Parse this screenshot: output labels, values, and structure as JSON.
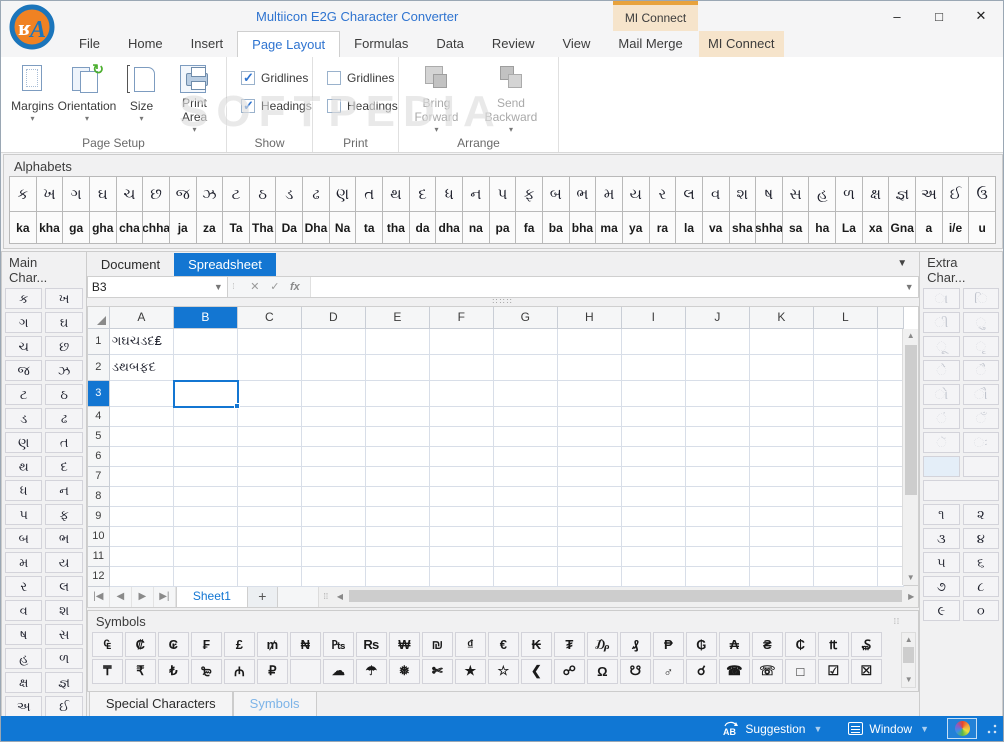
{
  "window": {
    "title": "Multiicon E2G Character Converter",
    "controls": [
      {
        "name": "minimize",
        "glyph": "–"
      },
      {
        "name": "maximize",
        "glyph": "□"
      },
      {
        "name": "close",
        "glyph": "✕"
      }
    ]
  },
  "ribbon": {
    "contextual_header": "MI Connect",
    "active_tab": "Page Layout",
    "tabs": [
      {
        "label": "File"
      },
      {
        "label": "Home"
      },
      {
        "label": "Insert"
      },
      {
        "label": "Page Layout"
      },
      {
        "label": "Formulas"
      },
      {
        "label": "Data"
      },
      {
        "label": "Review"
      },
      {
        "label": "View"
      },
      {
        "label": "Mail Merge"
      },
      {
        "label": "MI Connect",
        "contextual": true
      }
    ],
    "groups": {
      "page_setup": {
        "label": "Page Setup",
        "buttons": [
          "Margins",
          "Orientation",
          "Size",
          "Print Area"
        ]
      },
      "show": {
        "label": "Show",
        "checks": [
          {
            "label": "Gridlines",
            "checked": true
          },
          {
            "label": "Headings",
            "checked": true
          }
        ]
      },
      "print": {
        "label": "Print",
        "checks": [
          {
            "label": "Gridlines",
            "checked": false
          },
          {
            "label": "Headings",
            "checked": false
          }
        ]
      },
      "arrange": {
        "label": "Arrange",
        "buttons": [
          "Bring Forward",
          "Send Backward"
        ]
      }
    }
  },
  "watermark": {
    "text": "SOFTPEDIA"
  },
  "alphabets": {
    "title": "Alphabets",
    "letters": [
      "ક",
      "ખ",
      "ગ",
      "ઘ",
      "ચ",
      "છ",
      "જ",
      "ઝ",
      "ટ",
      "ઠ",
      "ડ",
      "ઢ",
      "ણ",
      "ત",
      "થ",
      "દ",
      "ધ",
      "ન",
      "પ",
      "ફ",
      "બ",
      "ભ",
      "મ",
      "ય",
      "ર",
      "લ",
      "વ",
      "શ",
      "ષ",
      "સ",
      "હ",
      "ળ",
      "ક્ષ",
      "જ્ઞ",
      "અ",
      "ઈ",
      "ઉ"
    ],
    "translits": [
      "ka",
      "kha",
      "ga",
      "gha",
      "cha",
      "chha",
      "ja",
      "za",
      "Ta",
      "Tha",
      "Da",
      "Dha",
      "Na",
      "ta",
      "tha",
      "da",
      "dha",
      "na",
      "pa",
      "fa",
      "ba",
      "bha",
      "ma",
      "ya",
      "ra",
      "la",
      "va",
      "sha",
      "shha",
      "sa",
      "ha",
      "La",
      "xa",
      "Gna",
      "a",
      "i/e",
      "u"
    ]
  },
  "main_chars": {
    "title": "Main Char...",
    "pairs": [
      [
        "ક",
        "ખ"
      ],
      [
        "ગ",
        "ઘ"
      ],
      [
        "ચ",
        "છ"
      ],
      [
        "જ",
        "ઝ"
      ],
      [
        "ટ",
        "ઠ"
      ],
      [
        "ડ",
        "ઢ"
      ],
      [
        "ણ",
        "ત"
      ],
      [
        "થ",
        "દ"
      ],
      [
        "ધ",
        "ન"
      ],
      [
        "પ",
        "ફ"
      ],
      [
        "બ",
        "ભ"
      ],
      [
        "મ",
        "ય"
      ],
      [
        "ર",
        "લ"
      ],
      [
        "વ",
        "શ"
      ],
      [
        "ષ",
        "સ"
      ],
      [
        "હ",
        "ળ"
      ],
      [
        "ક્ષ",
        "જ્ઞ"
      ],
      [
        "અ",
        "ઈ"
      ]
    ]
  },
  "extra_chars": {
    "title": "Extra Char...",
    "matras": [
      [
        "ા",
        "િ"
      ],
      [
        "ી",
        "ુ"
      ],
      [
        "ૂ",
        "ૃ"
      ],
      [
        "ે",
        "ૈ"
      ],
      [
        "ો",
        "ૌ"
      ],
      [
        "ં",
        "ઁ"
      ],
      [
        "ૅ",
        "ઃ"
      ]
    ],
    "numerals": [
      [
        "૧",
        "૨"
      ],
      [
        "૩",
        "૪"
      ],
      [
        "૫",
        "૬"
      ],
      [
        "૭",
        "૮"
      ],
      [
        "૯",
        "૦"
      ]
    ]
  },
  "editor": {
    "tabs": [
      "Document",
      "Spreadsheet"
    ],
    "active_tab": "Spreadsheet",
    "name_box": "B3",
    "formula_value": "",
    "formula_buttons": [
      "✕",
      "✓",
      "fx"
    ],
    "nav": [
      "|◀",
      "◀",
      "▶",
      "▶|"
    ],
    "add_sheet": "+"
  },
  "spreadsheet": {
    "columns": [
      "A",
      "B",
      "C",
      "D",
      "E",
      "F",
      "G",
      "H",
      "I",
      "J",
      "K",
      "L"
    ],
    "row_count": 12,
    "cells": {
      "A1": "ગઘચડદ₤",
      "A2": "ડથબફદ"
    },
    "selection": {
      "col": "B",
      "row": 3
    },
    "sheet_tab": "Sheet1"
  },
  "symbols": {
    "title": "Symbols",
    "row1": [
      "₠",
      "₡",
      "₢",
      "₣",
      "£",
      "₥",
      "₦",
      "₧",
      "₨",
      "₩",
      "₪",
      "₫",
      "€",
      "₭",
      "₮",
      "₯",
      "₰",
      "₱",
      "₲",
      "₳",
      "₴",
      "₵",
      "₶",
      "₷"
    ],
    "row2": [
      "₸",
      "₹",
      "₺",
      "₻",
      "₼",
      "₽",
      "",
      "☁",
      "☂",
      "❅",
      "✄",
      "★",
      "☆",
      "❮",
      "☍",
      "Ω",
      "☋",
      "♂",
      "☌",
      "☎",
      "☏",
      "□",
      "☑",
      "☒"
    ]
  },
  "bottom_tabs": {
    "items": [
      "Special Characters",
      "Symbols"
    ],
    "active": "Symbols"
  },
  "status_bar": {
    "suggestion": "Suggestion",
    "window": "Window"
  }
}
